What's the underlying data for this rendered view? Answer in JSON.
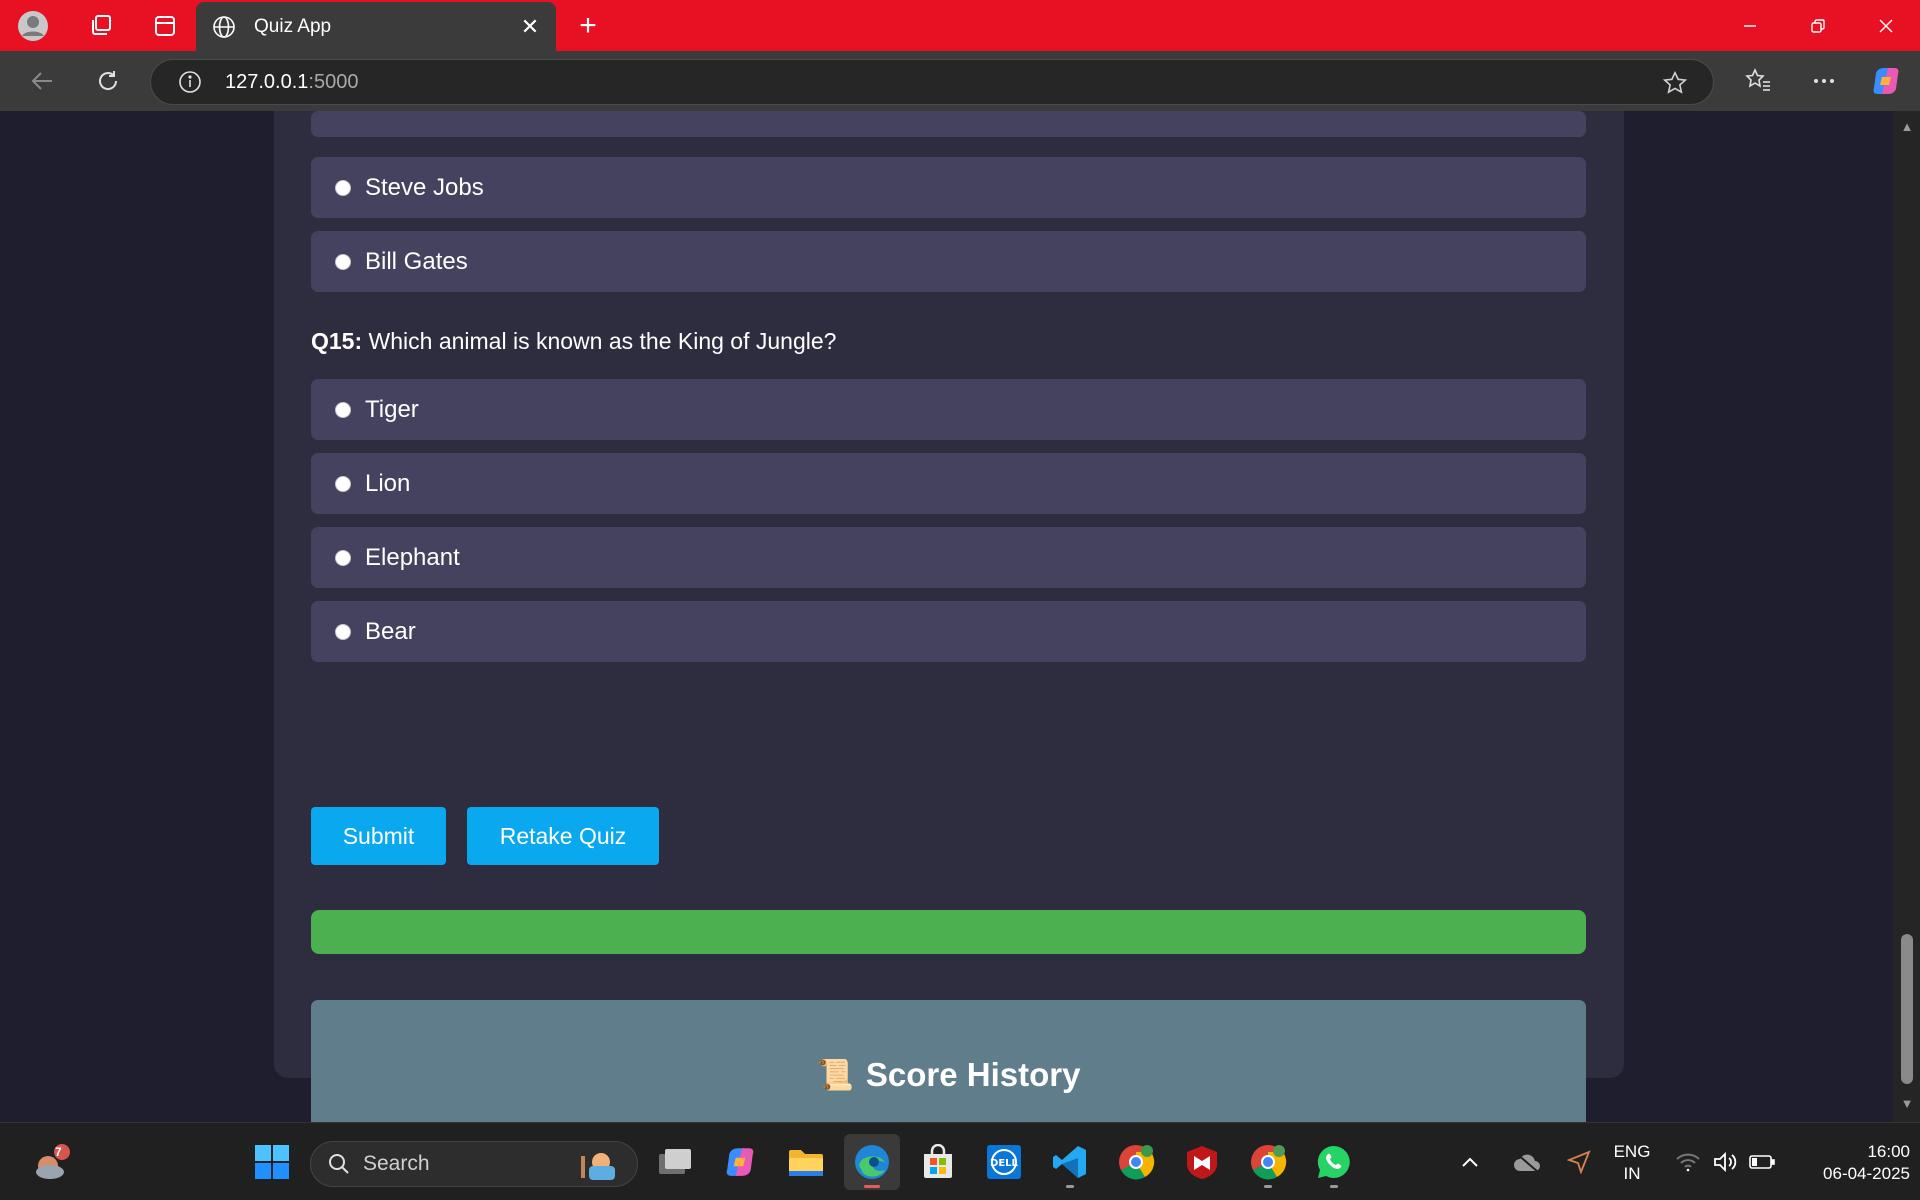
{
  "browser": {
    "tab_title": "Quiz App",
    "url_host": "127.0.0.1",
    "url_port": ":5000"
  },
  "quiz": {
    "prev_options": [
      "Steve Jobs",
      "Bill Gates"
    ],
    "q15": {
      "number": "Q15:",
      "text": "Which animal is known as the King of Jungle?",
      "options": [
        "Tiger",
        "Lion",
        "Elephant",
        "Bear"
      ]
    },
    "submit_label": "Submit",
    "retake_label": "Retake Quiz",
    "progress": 1.0,
    "score_history_title": "Score History"
  },
  "colors": {
    "titlebar": "#e81123",
    "option_bg": "#44425e",
    "card_bg": "#2e2c3f",
    "button": "#0aa8ef",
    "progress": "#4caf50",
    "history_bg": "#5f7d8b"
  },
  "taskbar": {
    "search_placeholder": "Search",
    "lang_line1": "ENG",
    "lang_line2": "IN",
    "time": "16:00",
    "date": "06-04-2025",
    "weather_badge": "7",
    "icons": [
      "windows-start-icon",
      "task-view-icon",
      "copilot-icon",
      "file-explorer-icon",
      "edge-icon",
      "microsoft-store-icon",
      "dell-icon",
      "vscode-icon",
      "chrome-icon",
      "mcafee-icon",
      "chrome-profile-icon",
      "whatsapp-icon"
    ]
  }
}
